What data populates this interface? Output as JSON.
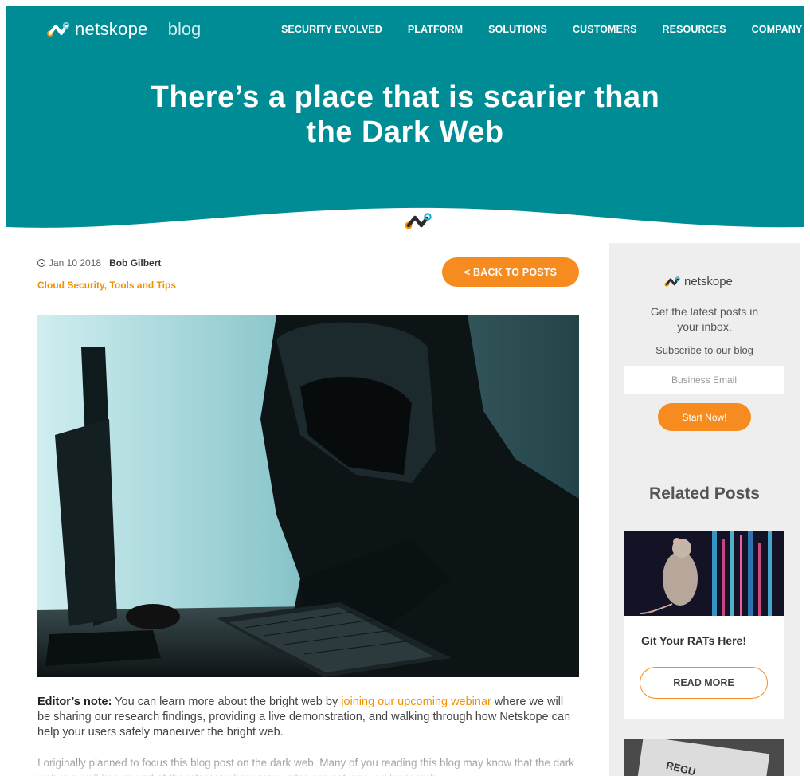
{
  "header": {
    "brand": "netskope",
    "section": "blog",
    "nav": [
      "SECURITY EVOLVED",
      "PLATFORM",
      "SOLUTIONS",
      "CUSTOMERS",
      "RESOURCES",
      "COMPANY"
    ],
    "title_line1": "There’s a place that is scarier than",
    "title_line2": "the Dark Web"
  },
  "post": {
    "date": "Jan 10 2018",
    "author": "Bob Gilbert",
    "categories": "Cloud Security, Tools and Tips",
    "back_label": "< BACK TO POSTS",
    "editors_label": "Editor’s note:",
    "editors_text_1": " You can learn more about the bright web by ",
    "editors_link": "joining our upcoming webinar",
    "editors_text_2": " where we will be sharing our research findings, providing a live demonstration, and walking through how Netskope can help your users safely maneuver the bright web.",
    "para2": "I originally planned to focus this blog post on the dark web. Many of you reading this blog may know that the dark web is a well known part of the internet where many sites are not indexed by search"
  },
  "sidebar": {
    "brand": "netskope",
    "latest": "Get the latest posts in your inbox.",
    "subscribe": "Subscribe to our blog",
    "email_placeholder": "Business Email",
    "start_label": "Start Now!",
    "related_heading": "Related Posts",
    "related": [
      {
        "title": "Git Your RATs Here!",
        "button": "READ MORE"
      },
      {
        "image_text": "REGU"
      }
    ]
  },
  "colors": {
    "hero": "#008c95",
    "accent": "#f68b1f",
    "sidebar_bg": "#eeeeee"
  }
}
